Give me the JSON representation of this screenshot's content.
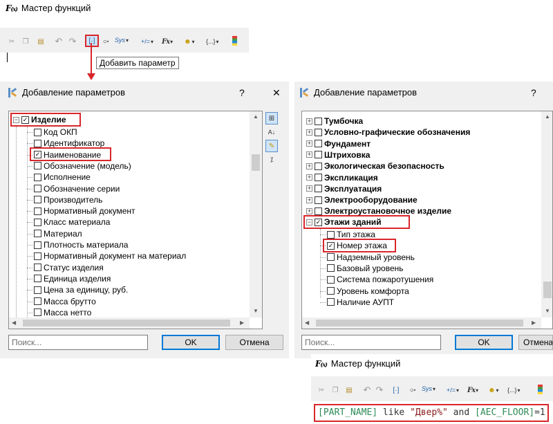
{
  "top_window": {
    "title": "Мастер функций",
    "tooltip": "Добавить параметр",
    "toolbar": {
      "sys_label": "Sys",
      "assign_label": "+/=",
      "fx_label": "Fx",
      "fx_sub": "(x)",
      "braces_label": "{...}"
    }
  },
  "left_dialog": {
    "title": "Добавление параметров",
    "help": "?",
    "close": "✕",
    "root_item": "Изделие",
    "items": [
      "Код ОКП",
      "Идентификатор",
      "Наименование",
      "Обозначение (модель)",
      "Исполнение",
      "Обозначение серии",
      "Производитель",
      "Нормативный документ",
      "Класс материала",
      "Материал",
      "Плотность материала",
      "Нормативный документ на материал",
      "Статус изделия",
      "Единица изделия",
      "Цена за единицу, руб.",
      "Масса брутто",
      "Масса нетто"
    ],
    "search_placeholder": "Поиск...",
    "ok_label": "OK",
    "cancel_label": "Отмена"
  },
  "right_dialog": {
    "title": "Добавление параметров",
    "help": "?",
    "groups": [
      "Тумбочка",
      "Условно-графические обозначения",
      "Фундамент",
      "Штриховка",
      "Экологическая безопасность",
      "Экспликация",
      "Эксплуатация",
      "Электрооборудование",
      "Электроустановочное изделие"
    ],
    "open_group": "Этажи зданий",
    "items": [
      "Тип этажа",
      "Номер этажа",
      "Надземный уровень",
      "Базовый уровень",
      "Система пожаротушения",
      "Уровень комфорта",
      "Наличие АУПТ"
    ],
    "search_placeholder": "Поиск...",
    "ok_label": "OK",
    "cancel_label": "Отмена"
  },
  "bottom_window": {
    "title": "Мастер функций",
    "expression": {
      "param1": "[PART_NAME]",
      "op1": " like ",
      "str": "\"Двер%\"",
      "op2": " and ",
      "param2": "[AEC_FLOOR]",
      "op3": "=",
      "num": "1"
    }
  },
  "colors": {
    "highlight_red": "#d9262b",
    "param_color": "#2e8b57",
    "string_color": "#8b1a1a",
    "keyword_color": "#333333",
    "button_accent": "#0078d7"
  }
}
